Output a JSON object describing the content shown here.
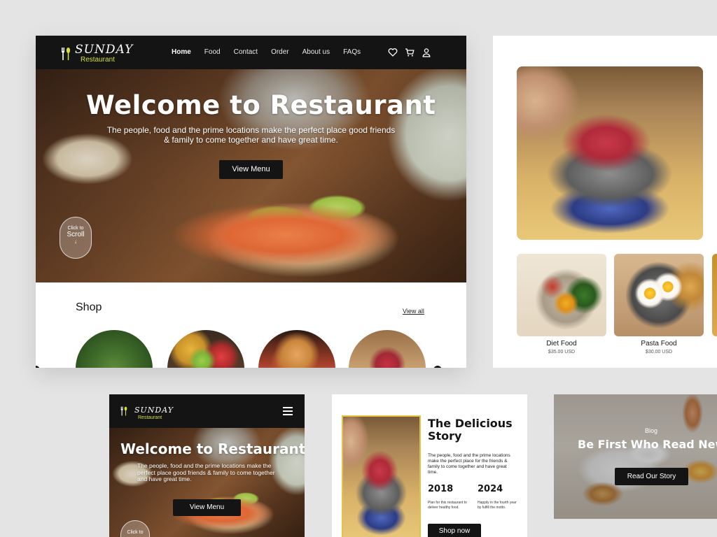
{
  "brand": {
    "script": "SUNDAY",
    "sub": "Restaurant",
    "accent": "#d6df3b",
    "nav_bg": "#141414"
  },
  "nav": {
    "items": [
      "Home",
      "Food",
      "Contact",
      "Order",
      "About us",
      "FAQs"
    ],
    "active": "Home",
    "icons": [
      "heart-icon",
      "cart-icon",
      "user-icon"
    ]
  },
  "hero": {
    "title": "Welcome to Restaurant",
    "text": "The people, food and the prime locations make the perfect place good friends & family to come together and have great time.",
    "button": "View Menu",
    "scroll": {
      "line1": "Click to",
      "line2": "Scroll",
      "arrow": "↓"
    }
  },
  "shop": {
    "title": "Shop",
    "view_all": "View all"
  },
  "products": [
    {
      "name": "Diet Food",
      "price": "$35.00 USD"
    },
    {
      "name": "Pasta Food",
      "price": "$30.00 USD"
    }
  ],
  "mobile": {
    "title": "Welcome to Restaurant",
    "text": "The people, food and the prime locations make the perfect place good friends & family to come together and have great time.",
    "button": "View Menu",
    "scroll_line1": "Click to"
  },
  "story": {
    "title": "The Delicious Story",
    "body": "The people, food and the prime locations make the perfect place for the friends & family to come together and have great time.",
    "years": [
      {
        "year": "2018",
        "desc": "Plan for this restaurant to deliver healthy food."
      },
      {
        "year": "2024",
        "desc": "Happily in the fourth year by fulfill the motto."
      }
    ],
    "button": "Shop now",
    "frame_color": "#e3c24a"
  },
  "blog": {
    "label": "Blog",
    "title": "Be First Who Read New",
    "button": "Read Our Story"
  }
}
